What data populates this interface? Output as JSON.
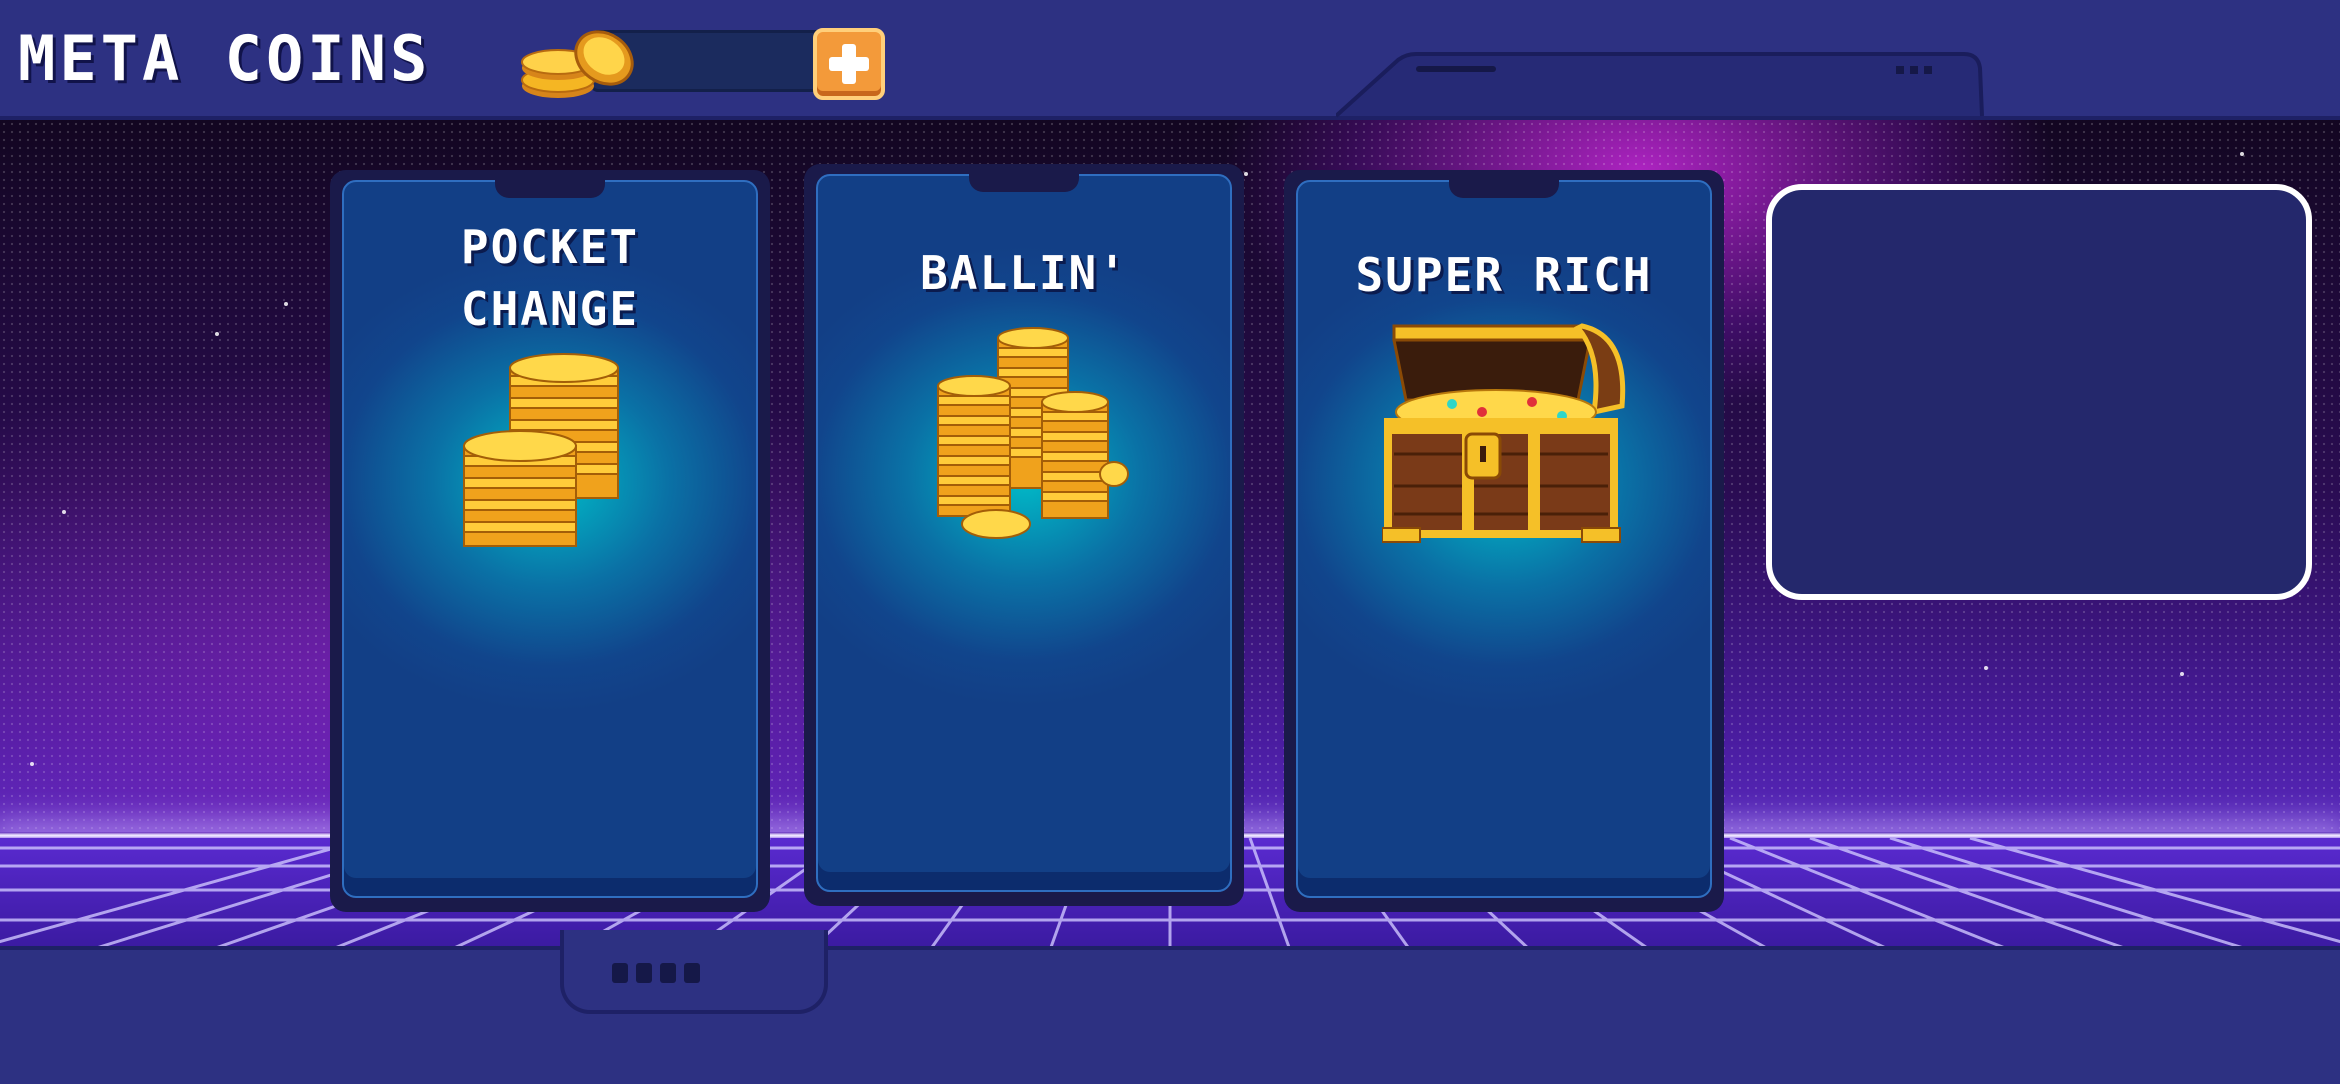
{
  "header": {
    "title": "META COINS",
    "coin_balance": "",
    "icons": {
      "coin": "coin-stack-icon",
      "add": "plus-icon"
    }
  },
  "cards": [
    {
      "name": "pocket-change",
      "title_line1": "POCKET",
      "title_line2": "CHANGE",
      "art": "small-coin-stacks-icon"
    },
    {
      "name": "ballin",
      "title": "BALLIN'",
      "art": "coin-towers-icon"
    },
    {
      "name": "super-rich",
      "title": "SUPER RICH",
      "art": "treasure-chest-icon"
    }
  ],
  "empty_slot": {
    "label": ""
  },
  "footer": {
    "pips": 4
  },
  "colors": {
    "accent_orange": "#f39a3a",
    "frame_navy": "#2d3182",
    "card_teal": "#00bcc8",
    "gold": "#f5b623"
  }
}
